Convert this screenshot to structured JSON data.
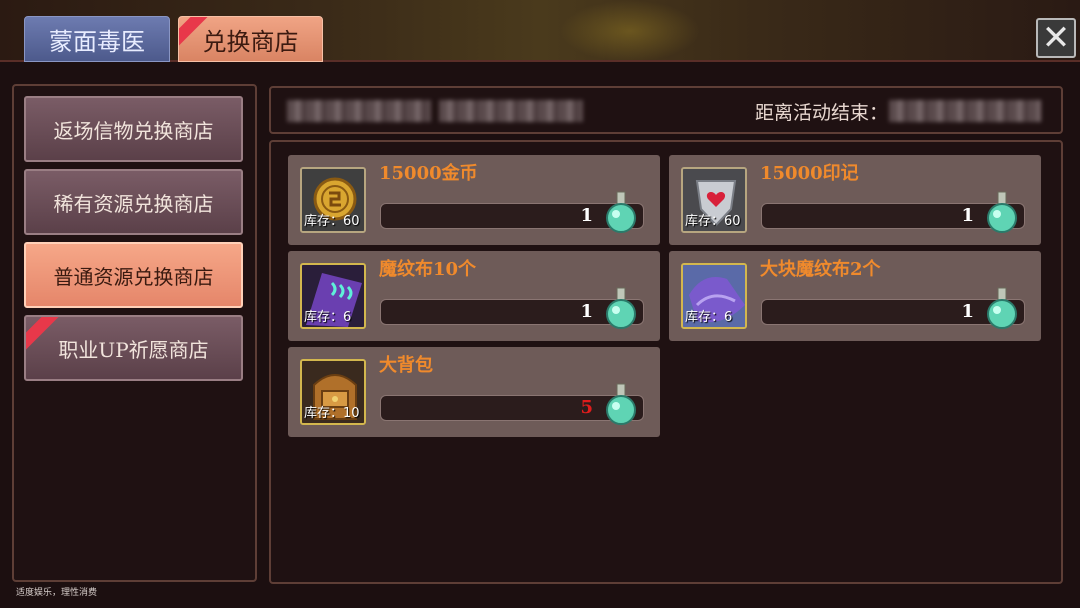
{
  "tabs": {
    "doctor_label": "蒙面毒医",
    "shop_label": "兑换商店"
  },
  "sidebar": {
    "items": [
      {
        "label": "返场信物兑换商店"
      },
      {
        "label": "稀有资源兑换商店"
      },
      {
        "label": "普通资源兑换商店"
      },
      {
        "label": "职业UP祈愿商店"
      }
    ]
  },
  "info_bar": {
    "countdown_label": "距离活动结束："
  },
  "items": [
    {
      "name": "15000金币",
      "stock": "库存：60",
      "price": "1",
      "icon": "gold-coin-icon"
    },
    {
      "name": "15000印记",
      "stock": "库存：60",
      "price": "1",
      "icon": "heart-shield-icon"
    },
    {
      "name": "魔纹布10个",
      "stock": "库存：6",
      "price": "1",
      "icon": "rune-cloth-icon"
    },
    {
      "name": "大块魔纹布2个",
      "stock": "库存：6",
      "price": "1",
      "icon": "large-rune-cloth-icon"
    },
    {
      "name": "大背包",
      "stock": "库存：10",
      "price": "5",
      "icon": "backpack-icon"
    }
  ],
  "footer": {
    "note": "适度娱乐，理性消费"
  },
  "colors": {
    "active_tab": "#e5866a",
    "item_name": "#f08a2c",
    "price_insufficient": "#e01c1c"
  }
}
